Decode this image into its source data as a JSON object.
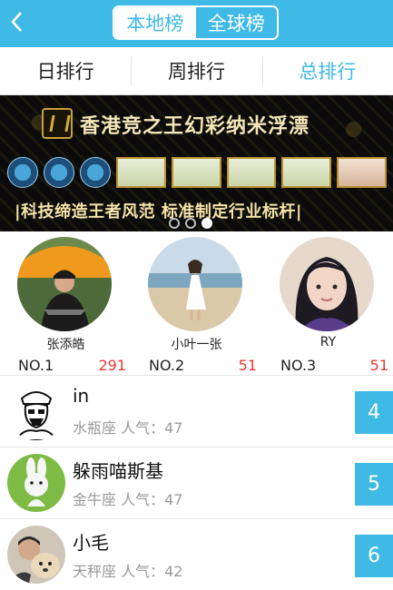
{
  "header": {
    "back_icon": "chevron-left-icon",
    "tabs": [
      {
        "label": "本地榜",
        "active": true
      },
      {
        "label": "全球榜",
        "active": false
      }
    ],
    "accent_color": "#3fb9e6"
  },
  "period_tabs": [
    {
      "label": "日排行",
      "selected": false
    },
    {
      "label": "周排行",
      "selected": false
    },
    {
      "label": "总排行",
      "selected": true
    }
  ],
  "banner": {
    "title": "香港竞之王幻彩纳米浮漂",
    "slogan": "|科技缔造王者风范 标准制定行业标杆|",
    "page_count": 3,
    "active_page": 3
  },
  "podium": [
    {
      "name": "张添皓",
      "rank_label": "NO.1",
      "score": "291",
      "avatar": "man-under-umbrella-avatar"
    },
    {
      "name": "小叶一张",
      "rank_label": "NO.2",
      "score": "51",
      "avatar": "girl-on-beach-avatar"
    },
    {
      "name": "RY",
      "rank_label": "NO.3",
      "score": "51",
      "avatar": "girl-portrait-avatar"
    }
  ],
  "list": [
    {
      "name": "in",
      "sign": "水瓶座",
      "pop_label": "人气：47",
      "rank": "4",
      "avatar": "sketch-avatar"
    },
    {
      "name": "躲雨喵斯基",
      "sign": "金牛座",
      "pop_label": "人气：47",
      "rank": "5",
      "avatar": "cartoon-rabbit-avatar"
    },
    {
      "name": "小毛",
      "sign": "天秤座",
      "pop_label": "人气：42",
      "rank": "6",
      "avatar": "man-with-dog-avatar"
    }
  ],
  "colors": {
    "score_red": "#e53935",
    "secondary_text": "#9a9a9a"
  }
}
